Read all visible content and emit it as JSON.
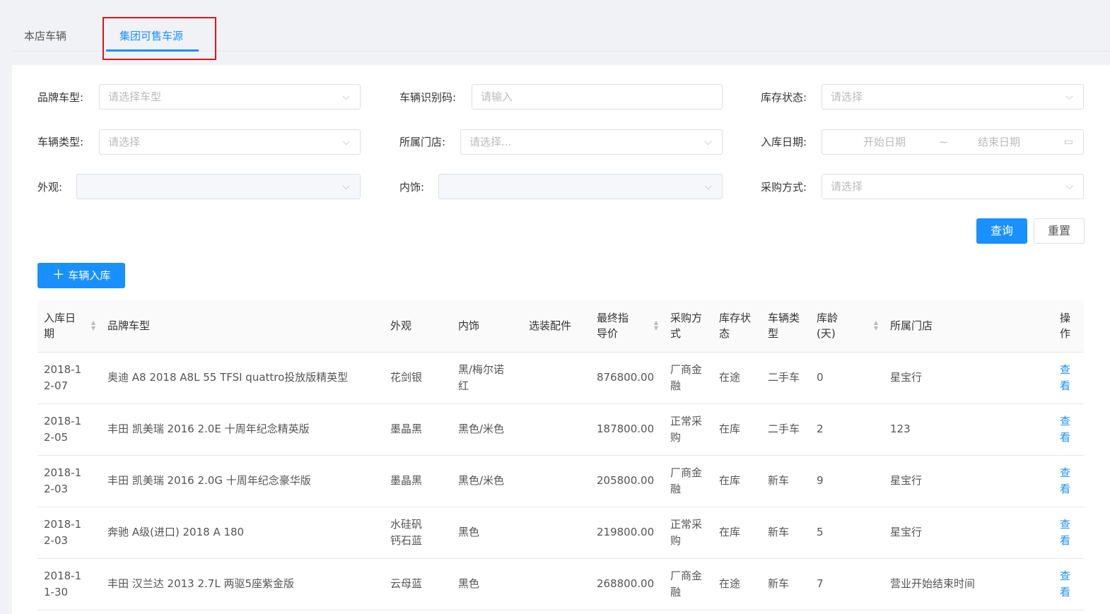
{
  "tabs": [
    {
      "label": "本店车辆"
    },
    {
      "label": "集团可售车源"
    }
  ],
  "filters": {
    "brand": {
      "label": "品牌车型:",
      "placeholder": "请选择车型"
    },
    "vin": {
      "label": "车辆识别码:",
      "placeholder": "请输入"
    },
    "stock_status": {
      "label": "库存状态:",
      "placeholder": "请选择"
    },
    "vehicle_type": {
      "label": "车辆类型:",
      "placeholder": "请选择"
    },
    "store": {
      "label": "所属门店:",
      "placeholder": "请选择..."
    },
    "date": {
      "label": "入库日期:",
      "start": "开始日期",
      "sep": "~",
      "end": "结束日期"
    },
    "exterior": {
      "label": "外观:",
      "placeholder": ""
    },
    "interior": {
      "label": "内饰:",
      "placeholder": ""
    },
    "purchase": {
      "label": "采购方式:",
      "placeholder": "请选择"
    }
  },
  "buttons": {
    "search": "查询",
    "reset": "重置",
    "add": "车辆入库"
  },
  "table": {
    "headers": [
      "入库日期",
      "品牌车型",
      "外观",
      "内饰",
      "选装配件",
      "最终指导价",
      "采购方式",
      "库存状态",
      "车辆类型",
      "库龄(天)",
      "所属门店",
      "操作"
    ],
    "rows": [
      [
        "2018-12-07",
        "奥迪 A8 2018 A8L 55 TFSI quattro投放版精英型",
        "花剑银",
        "黑/梅尔诺红",
        "",
        "876800.00",
        "厂商金融",
        "在途",
        "二手车",
        "0",
        "星宝行",
        "查看"
      ],
      [
        "2018-12-05",
        "丰田 凯美瑞 2016 2.0E 十周年纪念精英版",
        "墨晶黑",
        "黑色/米色",
        "",
        "187800.00",
        "正常采购",
        "在库",
        "二手车",
        "2",
        "123",
        "查看"
      ],
      [
        "2018-12-03",
        "丰田 凯美瑞 2016 2.0G 十周年纪念豪华版",
        "墨晶黑",
        "黑色/米色",
        "",
        "205800.00",
        "厂商金融",
        "在库",
        "新车",
        "9",
        "星宝行",
        "查看"
      ],
      [
        "2018-12-03",
        "奔驰 A级(进口) 2018 A 180",
        "水硅矾钙石蓝",
        "黑色",
        "",
        "219800.00",
        "正常采购",
        "在库",
        "新车",
        "5",
        "星宝行",
        "查看"
      ],
      [
        "2018-11-30",
        "丰田 汉兰达 2013 2.7L 两驱5座紫金版",
        "云母蓝",
        "黑色",
        "",
        "268800.00",
        "厂商金融",
        "在途",
        "新车",
        "7",
        "营业开始结束时间",
        "查看"
      ]
    ]
  }
}
